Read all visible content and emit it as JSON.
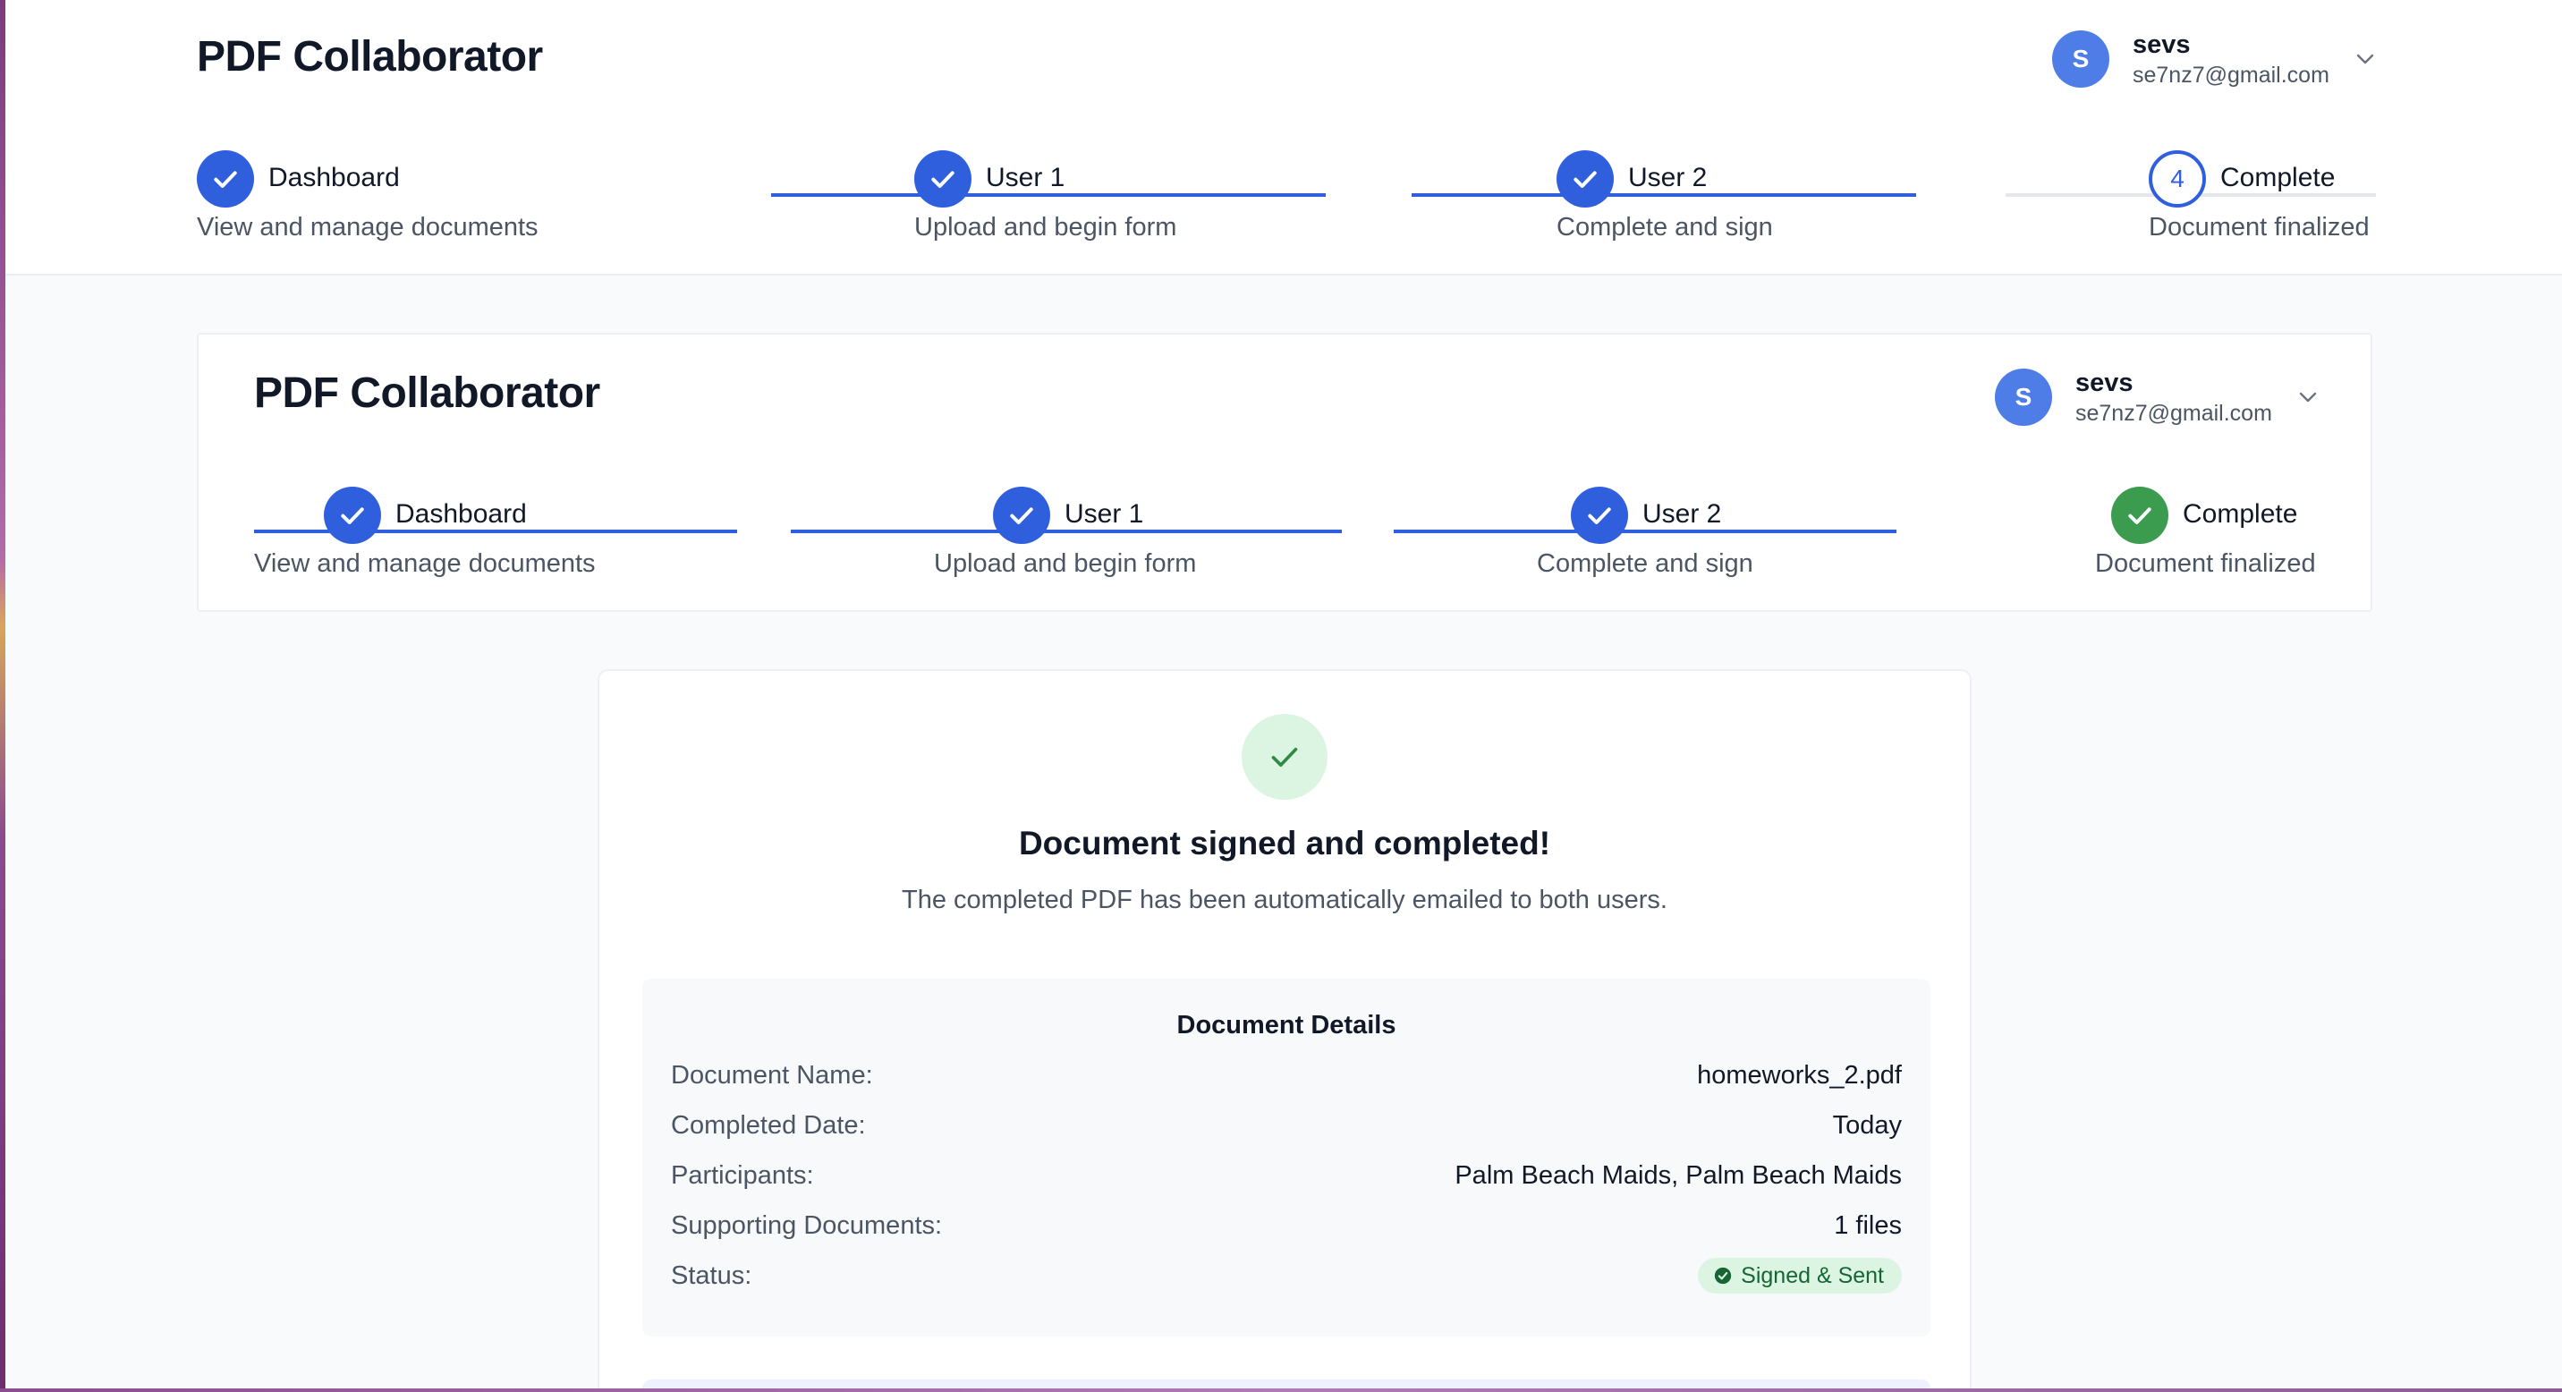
{
  "app": {
    "title": "PDF Collaborator",
    "user": {
      "initial": "S",
      "name": "sevs",
      "email": "se7nz7@gmail.com"
    }
  },
  "top_steps": [
    {
      "label": "Dashboard",
      "description": "View and manage documents",
      "state": "completed"
    },
    {
      "label": "User 1",
      "description": "Upload and begin form",
      "state": "completed"
    },
    {
      "label": "User 2",
      "description": "Complete and sign",
      "state": "completed"
    },
    {
      "label": "Complete",
      "description": "Document finalized",
      "state": "current",
      "number": "4"
    }
  ],
  "inner": {
    "title": "PDF Collaborator",
    "user": {
      "initial": "S",
      "name": "sevs",
      "email": "se7nz7@gmail.com"
    },
    "steps": [
      {
        "label": "Dashboard",
        "description": "View and manage documents",
        "state": "completed"
      },
      {
        "label": "User 1",
        "description": "Upload and begin form",
        "state": "completed"
      },
      {
        "label": "User 2",
        "description": "Complete and sign",
        "state": "completed"
      },
      {
        "label": "Complete",
        "description": "Document finalized",
        "state": "completed-success"
      }
    ]
  },
  "completion": {
    "heading": "Document signed and completed!",
    "message": "The completed PDF has been automatically emailed to both users.",
    "details": {
      "title": "Document Details",
      "rows": [
        {
          "label": "Document Name:",
          "value": "homeworks_2.pdf"
        },
        {
          "label": "Completed Date:",
          "value": "Today"
        },
        {
          "label": "Participants:",
          "value": "Palm Beach Maids, Palm Beach Maids"
        },
        {
          "label": "Supporting Documents:",
          "value": "1 files"
        },
        {
          "label": "Status:",
          "value": "Signed & Sent"
        }
      ]
    }
  },
  "colors": {
    "primary": "#2f5fdc",
    "avatar": "#4f7de8",
    "success": "#3b9b4f",
    "success_bg": "#dcf5e3",
    "success_text": "#166534"
  }
}
